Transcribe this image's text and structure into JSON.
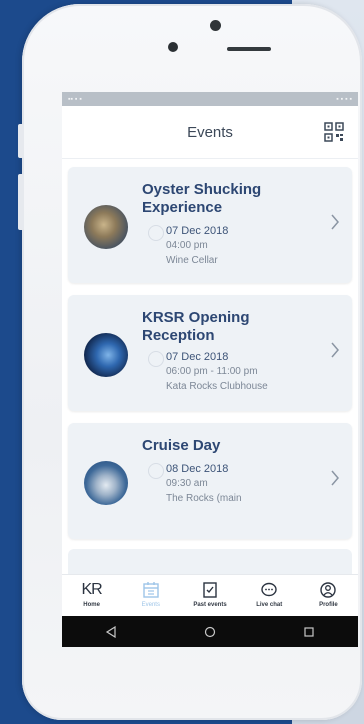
{
  "header": {
    "title": "Events"
  },
  "events": [
    {
      "title": "Oyster Shucking Experience",
      "date": "07 Dec 2018",
      "time": "04:00 pm",
      "location": "Wine Cellar"
    },
    {
      "title": "KRSR Opening Reception",
      "date": "07 Dec 2018",
      "time": "06:00 pm - 11:00 pm",
      "location": "Kata Rocks Clubhouse"
    },
    {
      "title": "Cruise Day",
      "date": "08 Dec 2018",
      "time": "09:30 am",
      "location": "The Rocks (main"
    }
  ],
  "tabs": [
    {
      "label": "Home",
      "icon": "kr-logo",
      "glyph": "KR"
    },
    {
      "label": "Events",
      "icon": "calendar-icon",
      "active": true
    },
    {
      "label": "Past events",
      "icon": "past-events-icon"
    },
    {
      "label": "Live chat",
      "icon": "chat-icon"
    },
    {
      "label": "Profile",
      "icon": "profile-icon"
    }
  ],
  "colors": {
    "background": "#1c4a8c",
    "card": "#eef2f6",
    "title": "#2d4773",
    "active_tab": "#9ec5e8"
  }
}
